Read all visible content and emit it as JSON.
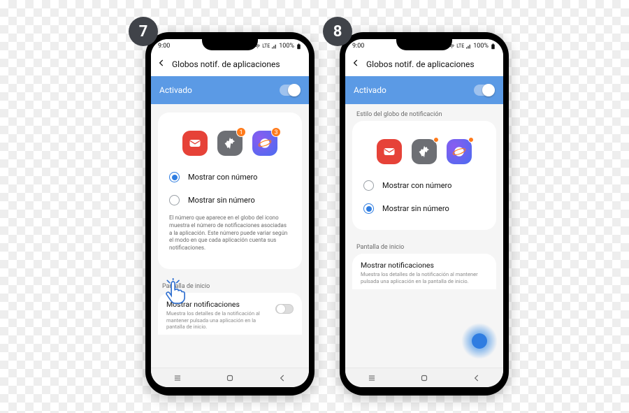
{
  "steps": {
    "seven": "7",
    "eight": "8"
  },
  "statusbar": {
    "time": "9:00",
    "lte": "LTE",
    "pct": "100%"
  },
  "header": {
    "title": "Globos notif. de aplicaciones"
  },
  "banner": {
    "label": "Activado"
  },
  "style_section": {
    "label": "Estilo del globo de notificación"
  },
  "badges": {
    "one": "1",
    "three": "3"
  },
  "radios": {
    "with_number": "Mostrar con número",
    "without_number": "Mostrar sin número"
  },
  "help7": "El número que aparece en el globo del icono muestra el número de notificaciones asociadas a la aplicación. Este número puede variar según el modo en que cada aplicación cuenta sus notificaciones.",
  "home": {
    "section": "Pantalla de inicio",
    "title": "Mostrar notificaciones",
    "sub": "Muestra los detalles de la notificación al mantener pulsada una aplicación en la pantalla de inicio."
  }
}
